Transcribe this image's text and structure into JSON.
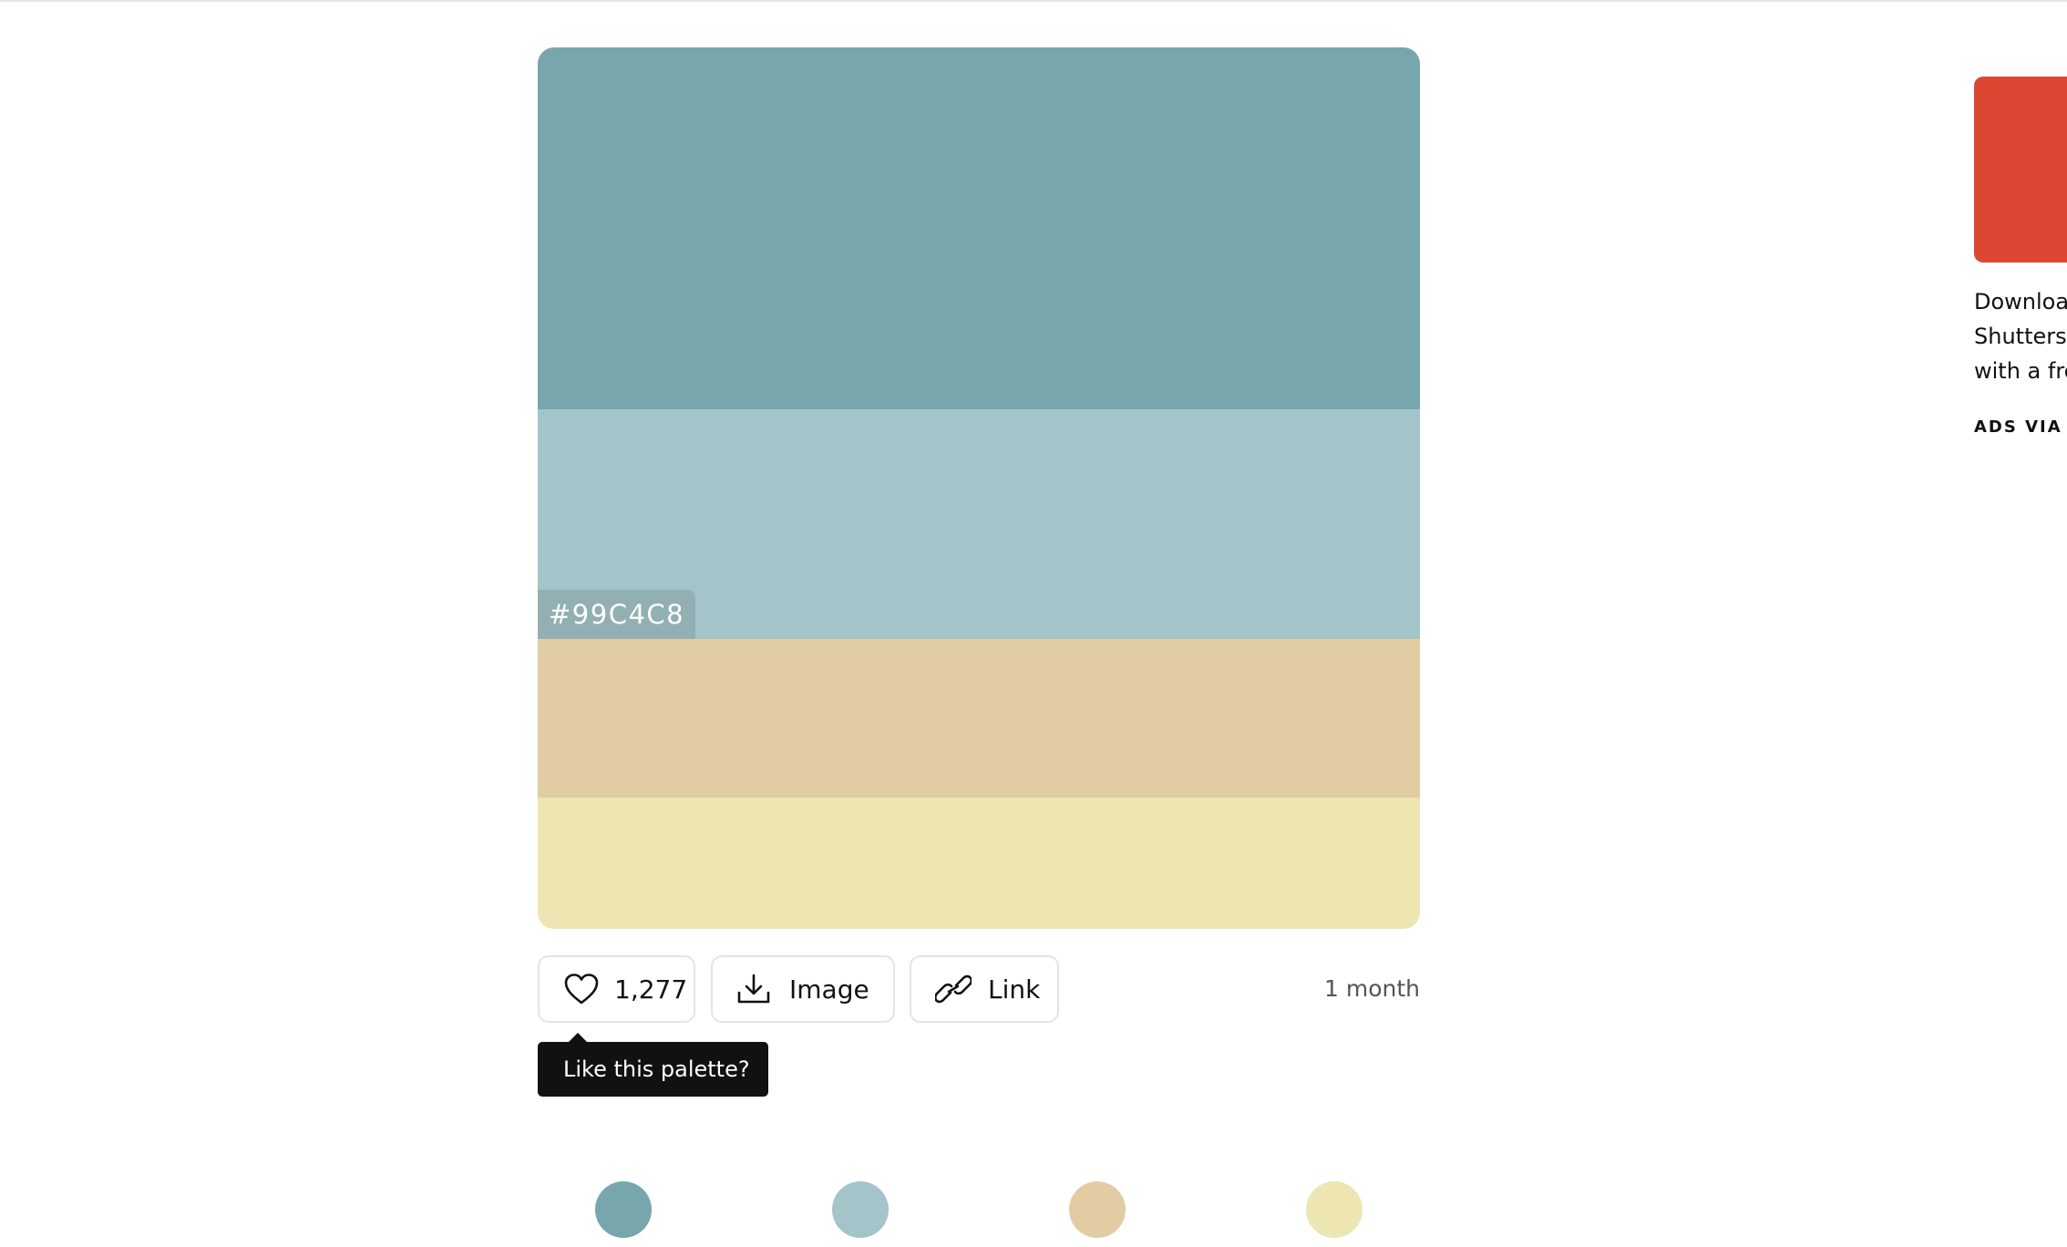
{
  "palette": {
    "swatches": [
      {
        "color": "#77A6AC"
      },
      {
        "color": "#A3C4C8"
      },
      {
        "color": "#E2CCA3"
      },
      {
        "color": "#EDE5B2"
      }
    ],
    "hover_hex": "#99C4C8"
  },
  "actions": {
    "likes": "1,277",
    "image_label": "Image",
    "link_label": "Link",
    "age": "1 month"
  },
  "tooltip": {
    "text": "Like this palette?"
  },
  "ad": {
    "image_color": "#DB4733",
    "line1": "Downloa",
    "line2": "Shutterst",
    "line3": "with a fre",
    "via": "ADS VIA"
  },
  "icons": {
    "like": "heart-icon",
    "image": "download-icon",
    "link": "link-icon"
  }
}
